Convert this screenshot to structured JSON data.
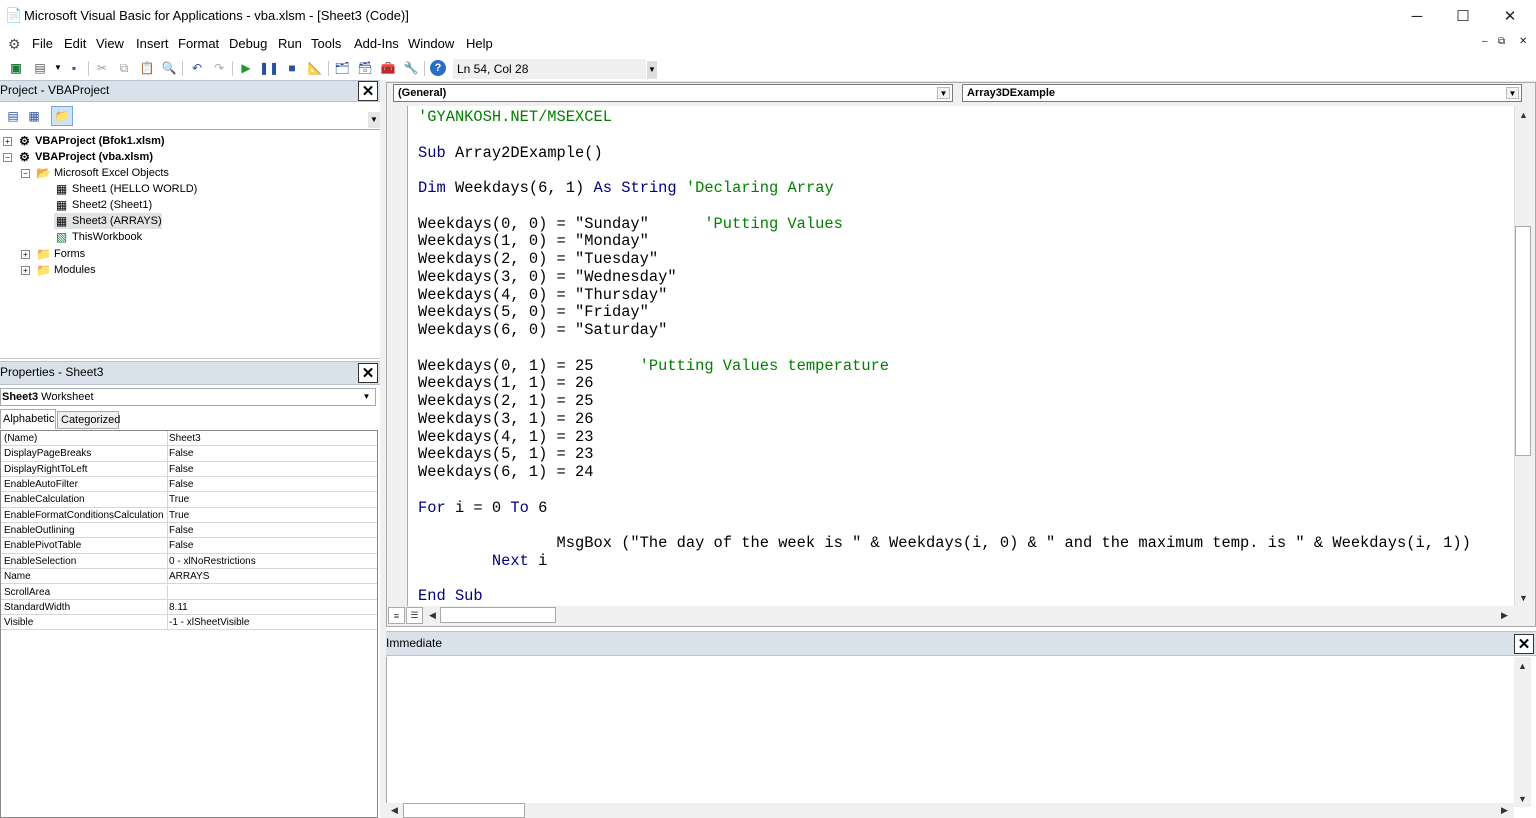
{
  "window": {
    "title": "Microsoft Visual Basic for Applications - vba.xlsm - [Sheet3 (Code)]",
    "minimize": "─",
    "maximize": "☐",
    "close": "✕"
  },
  "menu": [
    "File",
    "Edit",
    "View",
    "Insert",
    "Format",
    "Debug",
    "Run",
    "Tools",
    "Add-Ins",
    "Window",
    "Help"
  ],
  "mdi": {
    "minimize": "–",
    "restore": "⧉",
    "close": "✕"
  },
  "toolbar": {
    "cursor_position": "Ln 54, Col 28"
  },
  "project": {
    "title": "Project - VBAProject",
    "tree": [
      {
        "label": "VBAProject (Bfok1.xlsm)",
        "expander": "+",
        "icon": "vbaproject-icon"
      },
      {
        "label": "VBAProject (vba.xlsm)",
        "expander": "−",
        "icon": "vbaproject-icon"
      },
      {
        "label": "Microsoft Excel Objects",
        "expander": "−",
        "icon": "folder-icon"
      },
      {
        "label": "Sheet1 (HELLO WORLD)",
        "icon": "sheet-icon"
      },
      {
        "label": "Sheet2 (Sheet1)",
        "icon": "sheet-icon"
      },
      {
        "label": "Sheet3 (ARRAYS)",
        "icon": "sheet-icon"
      },
      {
        "label": "ThisWorkbook",
        "icon": "workbook-icon"
      },
      {
        "label": "Forms",
        "expander": "+",
        "icon": "folder-icon"
      },
      {
        "label": "Modules",
        "expander": "+",
        "icon": "folder-icon"
      }
    ]
  },
  "properties": {
    "title": "Properties - Sheet3",
    "object_name": "Sheet3",
    "object_type": "Worksheet",
    "tabs": [
      "Alphabetic",
      "Categorized"
    ],
    "rows": [
      {
        "name": "(Name)",
        "value": "Sheet3"
      },
      {
        "name": "DisplayPageBreaks",
        "value": "False"
      },
      {
        "name": "DisplayRightToLeft",
        "value": "False"
      },
      {
        "name": "EnableAutoFilter",
        "value": "False"
      },
      {
        "name": "EnableCalculation",
        "value": "True"
      },
      {
        "name": "EnableFormatConditionsCalculation",
        "value": "True"
      },
      {
        "name": "EnableOutlining",
        "value": "False"
      },
      {
        "name": "EnablePivotTable",
        "value": "False"
      },
      {
        "name": "EnableSelection",
        "value": "0 - xlNoRestrictions"
      },
      {
        "name": "Name",
        "value": "ARRAYS"
      },
      {
        "name": "ScrollArea",
        "value": ""
      },
      {
        "name": "StandardWidth",
        "value": "8.11"
      },
      {
        "name": "Visible",
        "value": "-1 - xlSheetVisible"
      }
    ]
  },
  "code_window": {
    "object_combo": "(General)",
    "procedure_combo": "Array3DExample",
    "lines": [
      [
        {
          "t": "'GYANKOSH.NET/MSEXCEL",
          "c": "cm"
        }
      ],
      [],
      [
        {
          "t": "Sub",
          "c": "kw"
        },
        {
          "t": " Array2DExample()"
        }
      ],
      [],
      [
        {
          "t": "Dim",
          "c": "kw"
        },
        {
          "t": " Weekdays(6, 1) "
        },
        {
          "t": "As",
          "c": "kw"
        },
        {
          "t": " "
        },
        {
          "t": "String",
          "c": "kw"
        },
        {
          "t": " "
        },
        {
          "t": "'Declaring Array",
          "c": "cm"
        }
      ],
      [],
      [
        {
          "t": "Weekdays(0, 0) = \"Sunday\"      "
        },
        {
          "t": "'Putting Values",
          "c": "cm"
        }
      ],
      [
        {
          "t": "Weekdays(1, 0) = \"Monday\""
        }
      ],
      [
        {
          "t": "Weekdays(2, 0) = \"Tuesday\""
        }
      ],
      [
        {
          "t": "Weekdays(3, 0) = \"Wednesday\""
        }
      ],
      [
        {
          "t": "Weekdays(4, 0) = \"Thursday\""
        }
      ],
      [
        {
          "t": "Weekdays(5, 0) = \"Friday\""
        }
      ],
      [
        {
          "t": "Weekdays(6, 0) = \"Saturday\""
        }
      ],
      [],
      [
        {
          "t": "Weekdays(0, 1) = 25     "
        },
        {
          "t": "'Putting Values temperature",
          "c": "cm"
        }
      ],
      [
        {
          "t": "Weekdays(1, 1) = 26"
        }
      ],
      [
        {
          "t": "Weekdays(2, 1) = 25"
        }
      ],
      [
        {
          "t": "Weekdays(3, 1) = 26"
        }
      ],
      [
        {
          "t": "Weekdays(4, 1) = 23"
        }
      ],
      [
        {
          "t": "Weekdays(5, 1) = 23"
        }
      ],
      [
        {
          "t": "Weekdays(6, 1) = 24"
        }
      ],
      [],
      [
        {
          "t": "For",
          "c": "kw"
        },
        {
          "t": " i = 0 "
        },
        {
          "t": "To",
          "c": "kw"
        },
        {
          "t": " 6"
        }
      ],
      [],
      [
        {
          "t": "               MsgBox (\"The day of the week is \" & Weekdays(i, 0) & \" and the maximum temp. is \" & Weekdays(i, 1))"
        }
      ],
      [
        {
          "t": "        "
        },
        {
          "t": "Next",
          "c": "kw"
        },
        {
          "t": " i"
        }
      ],
      [],
      [
        {
          "t": "End Sub",
          "c": "kw"
        }
      ]
    ]
  },
  "immediate": {
    "title": "Immediate"
  }
}
